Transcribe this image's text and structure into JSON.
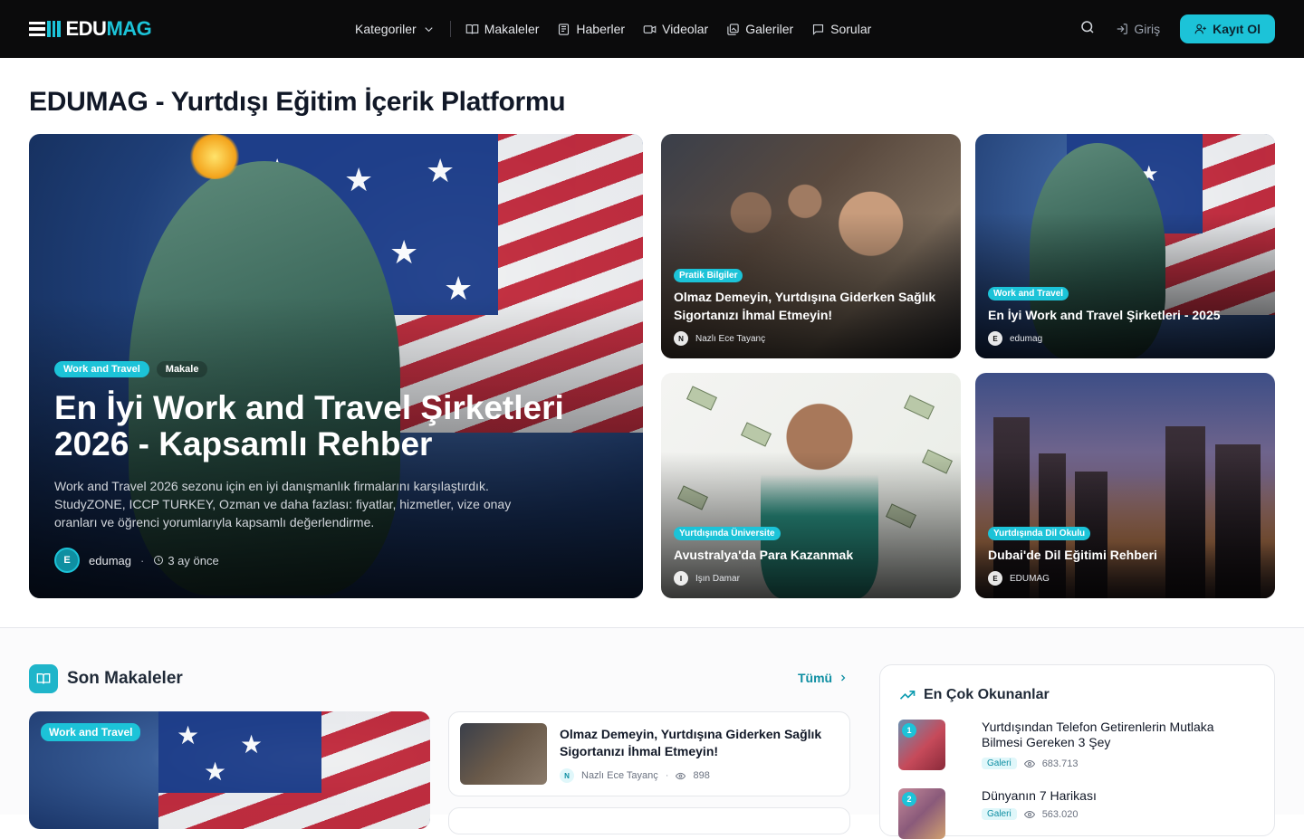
{
  "brand": {
    "name_prefix": "EDU",
    "name_suffix": "MAG"
  },
  "nav": {
    "items": [
      {
        "label": "Kategoriler",
        "icon": "chevron-down-icon"
      },
      {
        "label": "Makaleler",
        "icon": "book-open-icon"
      },
      {
        "label": "Haberler",
        "icon": "newspaper-icon"
      },
      {
        "label": "Videolar",
        "icon": "video-icon"
      },
      {
        "label": "Galeriler",
        "icon": "gallery-icon"
      },
      {
        "label": "Sorular",
        "icon": "message-icon"
      }
    ],
    "login": "Giriş",
    "register": "Kayıt Ol"
  },
  "page_title": "EDUMAG - Yurtdışı Eğitim İçerik Platformu",
  "hero": {
    "badges": [
      "Work and Travel",
      "Makale"
    ],
    "title": "En İyi Work and Travel Şirketleri 2026 - Kapsamlı Rehber",
    "description": "Work and Travel 2026 sezonu için en iyi danışmanlık firmalarını karşılaştırdık. StudyZONE, ICCP TURKEY, Ozman ve daha fazlası: fiyatlar, hizmetler, vize onay oranları ve öğrenci yorumlarıyla kapsamlı değerlendirme.",
    "author_initial": "E",
    "author": "edumag",
    "time": "3 ay önce"
  },
  "featured": [
    {
      "badge": "Pratik Bilgiler",
      "title": "Olmaz Demeyin, Yurtdışına Giderken Sağlık Sigortanızı İhmal Etmeyin!",
      "author_initial": "N",
      "author": "Nazlı Ece Tayanç"
    },
    {
      "badge": "Work and Travel",
      "title": "En İyi Work and Travel Şirketleri - 2025",
      "author_initial": "E",
      "author": "edumag"
    },
    {
      "badge": "Yurtdışında Üniversite",
      "title": "Avustralya'da Para Kazanmak",
      "author_initial": "I",
      "author": "Işın Damar"
    },
    {
      "badge": "Yurtdışında Dil Okulu",
      "title": "Dubai'de Dil Eğitimi Rehberi",
      "author_initial": "E",
      "author": "EDUMAG"
    }
  ],
  "latest": {
    "title": "Son Makaleler",
    "all_link": "Tümü",
    "big_badge": "Work and Travel",
    "articles": [
      {
        "title": "Olmaz Demeyin, Yurtdışına Giderken Sağlık Sigortanızı İhmal Etmeyin!",
        "author_initial": "N",
        "author": "Nazlı Ece Tayanç",
        "views": "898"
      }
    ]
  },
  "popular": {
    "title": "En Çok Okunanlar",
    "items": [
      {
        "rank": "1",
        "title": "Yurtdışından Telefon Getirenlerin Mutlaka Bilmesi Gereken 3 Şey",
        "tag": "Galeri",
        "views": "683.713"
      },
      {
        "rank": "2",
        "title": "Dünyanın 7 Harikası",
        "tag": "Galeri",
        "views": "563.020"
      }
    ]
  },
  "colors": {
    "accent": "#1cc3d8",
    "topbar": "#0b0b0c"
  }
}
